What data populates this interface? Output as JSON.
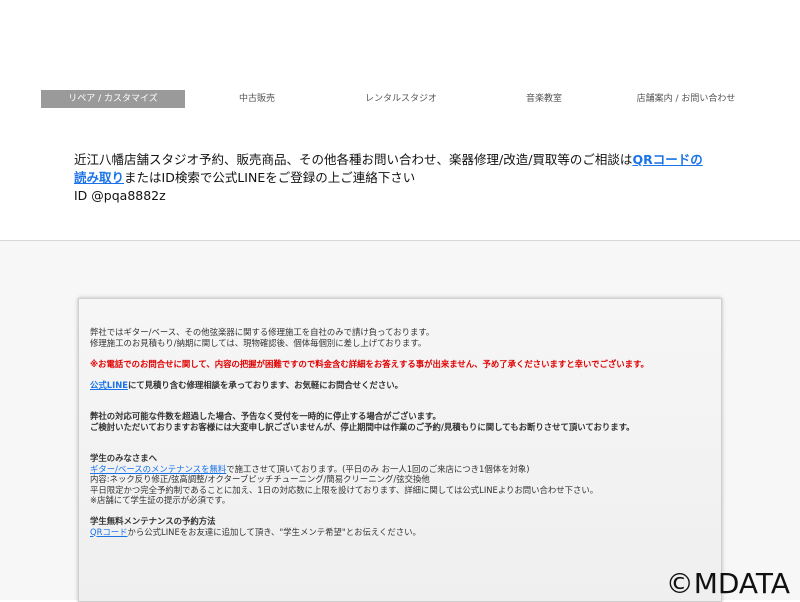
{
  "nav": {
    "items": [
      {
        "label": "リペア / カスタマイズ",
        "active": true
      },
      {
        "label": "中古販売",
        "active": false
      },
      {
        "label": "レンタルスタジオ",
        "active": false
      },
      {
        "label": "音楽教室",
        "active": false
      },
      {
        "label": "店舗案内 / お問い合わせ",
        "active": false
      }
    ]
  },
  "contact": {
    "text_before": "近江八幡店舗スタジオ予約、販売商品、その他各種お問い合わせ、楽器修理/改造/買取等のご相談は",
    "qr_link": "QRコードの読み取り",
    "text_after": "またはID検索で公式LINEをご登録の上ご連絡下さい",
    "line_id": "ID @pqa8882z"
  },
  "panel": {
    "intro1": "弊社ではギター/ベース、その他弦楽器に関する修理施工を自社のみで請け負っております。",
    "intro2": "修理施工のお見積もり/納期に関しては、現物確認後、個体毎個別に差し上げております。",
    "warning": "※お電話でのお問合せに関して、内容の把握が困難ですので料金含む詳細をお答えする事が出来ません、予め了承くださいますと幸いでございます。",
    "line_link": "公式LINE",
    "line_text": "にて見積り含む修理相談を承っております、お気軽にお問合せください。",
    "notice1": "弊社の対応可能な件数を超過した場合、予告なく受付を一時的に停止する場合がございます。",
    "notice2": "ご検討いただいておりますお客様には大変申し訳ございませんが、停止期間中は作業のご予約/見積もりに関してもお断りさせて頂いております。",
    "students_title": "学生のみなさまへ",
    "students_line1_link": "ギター/ベースのメンテナンスを無料",
    "students_line1_rest": "で施工させて頂いております。(平日のみ お一人1回のご来店につき1個体を対象)",
    "students_line2": "内容:ネック反り修正/弦高調整/オクターブピッチチューニング/簡易クリーニング/弦交換他",
    "students_line3": "平日限定かつ完全予約制であることに加え、1日の対応数に上限を設けております、詳細に関しては公式LINEよりお問い合わせ下さい。",
    "students_line4": "※店舗にて学生証の提示が必須です。",
    "booking_title": "学生無料メンテナンスの予約方法",
    "booking_link": "QRコード",
    "booking_rest": "から公式LINEをお友達に追加して頂き、\"学生メンテ希望\"とお伝えください。"
  },
  "watermark": "©MDATA"
}
